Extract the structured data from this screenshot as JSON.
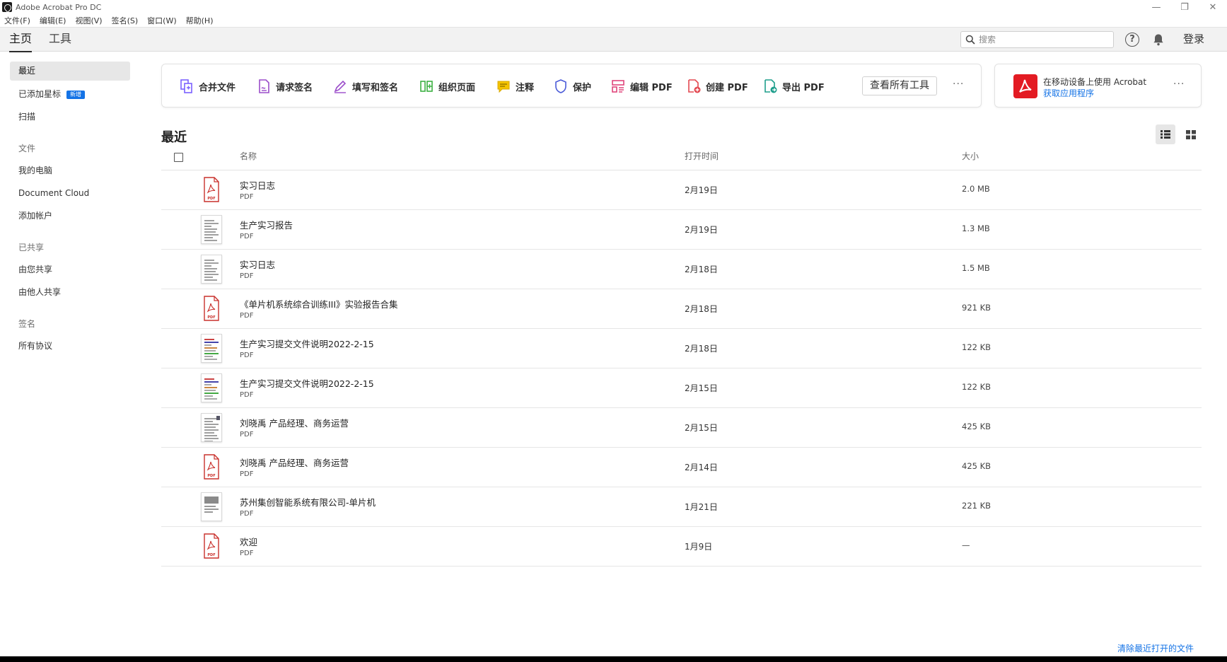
{
  "window": {
    "title": "Adobe Acrobat Pro DC",
    "controls": {
      "minimize": "—",
      "restore": "❐",
      "close": "✕"
    }
  },
  "menubar": [
    "文件(F)",
    "编辑(E)",
    "视图(V)",
    "签名(S)",
    "窗口(W)",
    "帮助(H)"
  ],
  "topnav": {
    "tabs": [
      "主页",
      "工具"
    ],
    "active_tab": "主页",
    "search_placeholder": "搜索",
    "login": "登录"
  },
  "sidebar": {
    "items": [
      {
        "label": "最近",
        "active": true
      },
      {
        "label": "已添加星标",
        "badge": "新增"
      },
      {
        "label": "扫描"
      }
    ],
    "sections": [
      {
        "header": "文件",
        "items": [
          "我的电脑",
          "Document Cloud",
          "添加帐户"
        ]
      },
      {
        "header": "已共享",
        "items": [
          "由您共享",
          "由他人共享"
        ]
      },
      {
        "header": "签名",
        "items": [
          "所有协议"
        ]
      }
    ]
  },
  "tools": {
    "items": [
      {
        "label": "合并文件",
        "icon": "combine-files-icon",
        "color": "#7b61ff"
      },
      {
        "label": "请求签名",
        "icon": "request-signature-icon",
        "color": "#9b4dca"
      },
      {
        "label": "填写和签名",
        "icon": "fill-sign-icon",
        "color": "#9b4dca"
      },
      {
        "label": "组织页面",
        "icon": "organize-pages-icon",
        "color": "#3cb043"
      },
      {
        "label": "注释",
        "icon": "comment-icon",
        "color": "#e8b400"
      },
      {
        "label": "保护",
        "icon": "protect-icon",
        "color": "#4b5bd8"
      },
      {
        "label": "编辑 PDF",
        "icon": "edit-pdf-icon",
        "color": "#e0457b"
      },
      {
        "label": "创建 PDF",
        "icon": "create-pdf-icon",
        "color": "#e34850"
      },
      {
        "label": "导出 PDF",
        "icon": "export-pdf-icon",
        "color": "#1e9e8c"
      }
    ],
    "view_all": "查看所有工具",
    "more": "···"
  },
  "promo": {
    "text": "在移动设备上使用 Acrobat",
    "link": "获取应用程序",
    "more": "···"
  },
  "recent": {
    "title": "最近",
    "columns": {
      "name": "名称",
      "opened": "打开时间",
      "size": "大小"
    },
    "files": [
      {
        "name": "实习日志",
        "type": "PDF",
        "opened": "2月19日",
        "size": "2.0 MB",
        "thumb": "pdf"
      },
      {
        "name": "生产实习报告",
        "type": "PDF",
        "opened": "2月19日",
        "size": "1.3 MB",
        "thumb": "doc"
      },
      {
        "name": "实习日志",
        "type": "PDF",
        "opened": "2月18日",
        "size": "1.5 MB",
        "thumb": "doc"
      },
      {
        "name": "《单片机系统综合训练III》实验报告合集",
        "type": "PDF",
        "opened": "2月18日",
        "size": "921 KB",
        "thumb": "pdf"
      },
      {
        "name": "生产实习提交文件说明2022-2-15",
        "type": "PDF",
        "opened": "2月18日",
        "size": "122 KB",
        "thumb": "doc-color"
      },
      {
        "name": "生产实习提交文件说明2022-2-15",
        "type": "PDF",
        "opened": "2月15日",
        "size": "122 KB",
        "thumb": "doc-color"
      },
      {
        "name": "刘晓禹 产品经理、商务运营",
        "type": "PDF",
        "opened": "2月15日",
        "size": "425 KB",
        "thumb": "doc-resume"
      },
      {
        "name": "刘晓禹 产品经理、商务运营",
        "type": "PDF",
        "opened": "2月14日",
        "size": "425 KB",
        "thumb": "pdf"
      },
      {
        "name": "苏州集创智能系统有限公司-单片机",
        "type": "PDF",
        "opened": "1月21日",
        "size": "221 KB",
        "thumb": "doc-image"
      },
      {
        "name": "欢迎",
        "type": "PDF",
        "opened": "1月9日",
        "size": "—",
        "thumb": "pdf"
      }
    ],
    "clear": "清除最近打开的文件"
  }
}
